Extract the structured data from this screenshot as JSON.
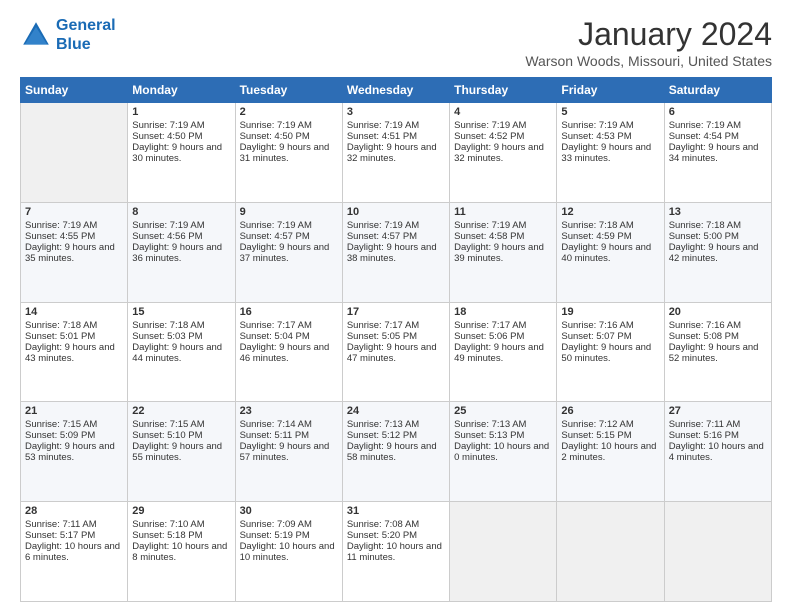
{
  "header": {
    "logo_line1": "General",
    "logo_line2": "Blue",
    "month_title": "January 2024",
    "location": "Warson Woods, Missouri, United States"
  },
  "days_of_week": [
    "Sunday",
    "Monday",
    "Tuesday",
    "Wednesday",
    "Thursday",
    "Friday",
    "Saturday"
  ],
  "weeks": [
    [
      {
        "day": "",
        "sunrise": "",
        "sunset": "",
        "daylight": ""
      },
      {
        "day": "1",
        "sunrise": "Sunrise: 7:19 AM",
        "sunset": "Sunset: 4:50 PM",
        "daylight": "Daylight: 9 hours and 30 minutes."
      },
      {
        "day": "2",
        "sunrise": "Sunrise: 7:19 AM",
        "sunset": "Sunset: 4:50 PM",
        "daylight": "Daylight: 9 hours and 31 minutes."
      },
      {
        "day": "3",
        "sunrise": "Sunrise: 7:19 AM",
        "sunset": "Sunset: 4:51 PM",
        "daylight": "Daylight: 9 hours and 32 minutes."
      },
      {
        "day": "4",
        "sunrise": "Sunrise: 7:19 AM",
        "sunset": "Sunset: 4:52 PM",
        "daylight": "Daylight: 9 hours and 32 minutes."
      },
      {
        "day": "5",
        "sunrise": "Sunrise: 7:19 AM",
        "sunset": "Sunset: 4:53 PM",
        "daylight": "Daylight: 9 hours and 33 minutes."
      },
      {
        "day": "6",
        "sunrise": "Sunrise: 7:19 AM",
        "sunset": "Sunset: 4:54 PM",
        "daylight": "Daylight: 9 hours and 34 minutes."
      }
    ],
    [
      {
        "day": "7",
        "sunrise": "Sunrise: 7:19 AM",
        "sunset": "Sunset: 4:55 PM",
        "daylight": "Daylight: 9 hours and 35 minutes."
      },
      {
        "day": "8",
        "sunrise": "Sunrise: 7:19 AM",
        "sunset": "Sunset: 4:56 PM",
        "daylight": "Daylight: 9 hours and 36 minutes."
      },
      {
        "day": "9",
        "sunrise": "Sunrise: 7:19 AM",
        "sunset": "Sunset: 4:57 PM",
        "daylight": "Daylight: 9 hours and 37 minutes."
      },
      {
        "day": "10",
        "sunrise": "Sunrise: 7:19 AM",
        "sunset": "Sunset: 4:57 PM",
        "daylight": "Daylight: 9 hours and 38 minutes."
      },
      {
        "day": "11",
        "sunrise": "Sunrise: 7:19 AM",
        "sunset": "Sunset: 4:58 PM",
        "daylight": "Daylight: 9 hours and 39 minutes."
      },
      {
        "day": "12",
        "sunrise": "Sunrise: 7:18 AM",
        "sunset": "Sunset: 4:59 PM",
        "daylight": "Daylight: 9 hours and 40 minutes."
      },
      {
        "day": "13",
        "sunrise": "Sunrise: 7:18 AM",
        "sunset": "Sunset: 5:00 PM",
        "daylight": "Daylight: 9 hours and 42 minutes."
      }
    ],
    [
      {
        "day": "14",
        "sunrise": "Sunrise: 7:18 AM",
        "sunset": "Sunset: 5:01 PM",
        "daylight": "Daylight: 9 hours and 43 minutes."
      },
      {
        "day": "15",
        "sunrise": "Sunrise: 7:18 AM",
        "sunset": "Sunset: 5:03 PM",
        "daylight": "Daylight: 9 hours and 44 minutes."
      },
      {
        "day": "16",
        "sunrise": "Sunrise: 7:17 AM",
        "sunset": "Sunset: 5:04 PM",
        "daylight": "Daylight: 9 hours and 46 minutes."
      },
      {
        "day": "17",
        "sunrise": "Sunrise: 7:17 AM",
        "sunset": "Sunset: 5:05 PM",
        "daylight": "Daylight: 9 hours and 47 minutes."
      },
      {
        "day": "18",
        "sunrise": "Sunrise: 7:17 AM",
        "sunset": "Sunset: 5:06 PM",
        "daylight": "Daylight: 9 hours and 49 minutes."
      },
      {
        "day": "19",
        "sunrise": "Sunrise: 7:16 AM",
        "sunset": "Sunset: 5:07 PM",
        "daylight": "Daylight: 9 hours and 50 minutes."
      },
      {
        "day": "20",
        "sunrise": "Sunrise: 7:16 AM",
        "sunset": "Sunset: 5:08 PM",
        "daylight": "Daylight: 9 hours and 52 minutes."
      }
    ],
    [
      {
        "day": "21",
        "sunrise": "Sunrise: 7:15 AM",
        "sunset": "Sunset: 5:09 PM",
        "daylight": "Daylight: 9 hours and 53 minutes."
      },
      {
        "day": "22",
        "sunrise": "Sunrise: 7:15 AM",
        "sunset": "Sunset: 5:10 PM",
        "daylight": "Daylight: 9 hours and 55 minutes."
      },
      {
        "day": "23",
        "sunrise": "Sunrise: 7:14 AM",
        "sunset": "Sunset: 5:11 PM",
        "daylight": "Daylight: 9 hours and 57 minutes."
      },
      {
        "day": "24",
        "sunrise": "Sunrise: 7:13 AM",
        "sunset": "Sunset: 5:12 PM",
        "daylight": "Daylight: 9 hours and 58 minutes."
      },
      {
        "day": "25",
        "sunrise": "Sunrise: 7:13 AM",
        "sunset": "Sunset: 5:13 PM",
        "daylight": "Daylight: 10 hours and 0 minutes."
      },
      {
        "day": "26",
        "sunrise": "Sunrise: 7:12 AM",
        "sunset": "Sunset: 5:15 PM",
        "daylight": "Daylight: 10 hours and 2 minutes."
      },
      {
        "day": "27",
        "sunrise": "Sunrise: 7:11 AM",
        "sunset": "Sunset: 5:16 PM",
        "daylight": "Daylight: 10 hours and 4 minutes."
      }
    ],
    [
      {
        "day": "28",
        "sunrise": "Sunrise: 7:11 AM",
        "sunset": "Sunset: 5:17 PM",
        "daylight": "Daylight: 10 hours and 6 minutes."
      },
      {
        "day": "29",
        "sunrise": "Sunrise: 7:10 AM",
        "sunset": "Sunset: 5:18 PM",
        "daylight": "Daylight: 10 hours and 8 minutes."
      },
      {
        "day": "30",
        "sunrise": "Sunrise: 7:09 AM",
        "sunset": "Sunset: 5:19 PM",
        "daylight": "Daylight: 10 hours and 10 minutes."
      },
      {
        "day": "31",
        "sunrise": "Sunrise: 7:08 AM",
        "sunset": "Sunset: 5:20 PM",
        "daylight": "Daylight: 10 hours and 11 minutes."
      },
      {
        "day": "",
        "sunrise": "",
        "sunset": "",
        "daylight": ""
      },
      {
        "day": "",
        "sunrise": "",
        "sunset": "",
        "daylight": ""
      },
      {
        "day": "",
        "sunrise": "",
        "sunset": "",
        "daylight": ""
      }
    ]
  ]
}
